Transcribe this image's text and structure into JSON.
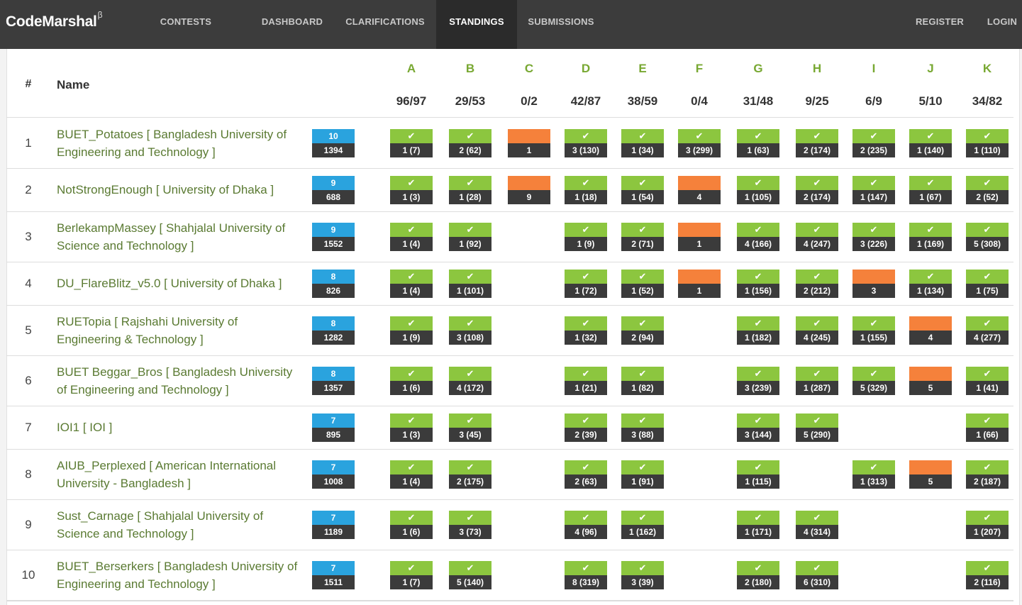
{
  "app": {
    "brand": "CodeMarshal",
    "brand_sup": "β"
  },
  "nav": {
    "items": [
      {
        "label": "CONTESTS",
        "active": false
      },
      {
        "label": "DASHBOARD",
        "active": false
      },
      {
        "label": "CLARIFICATIONS",
        "active": false
      },
      {
        "label": "STANDINGS",
        "active": true
      },
      {
        "label": "SUBMISSIONS",
        "active": false
      }
    ],
    "right": [
      {
        "label": "REGISTER"
      },
      {
        "label": "LOGIN"
      }
    ]
  },
  "colors": {
    "accepted": "#8cc63f",
    "rejected": "#f5813b",
    "solved_badge": "#2aa3de",
    "penalty_badge": "#3b3b3b",
    "team_link": "#5a7a32",
    "problem_letter": "#78a832"
  },
  "icons": {
    "accepted": "check-icon"
  },
  "header": {
    "hash": "#",
    "name": "Name"
  },
  "problems": [
    {
      "letter": "A",
      "stat": "96/97"
    },
    {
      "letter": "B",
      "stat": "29/53"
    },
    {
      "letter": "C",
      "stat": "0/2"
    },
    {
      "letter": "D",
      "stat": "42/87"
    },
    {
      "letter": "E",
      "stat": "38/59"
    },
    {
      "letter": "F",
      "stat": "0/4"
    },
    {
      "letter": "G",
      "stat": "31/48"
    },
    {
      "letter": "H",
      "stat": "9/25"
    },
    {
      "letter": "I",
      "stat": "6/9"
    },
    {
      "letter": "J",
      "stat": "5/10"
    },
    {
      "letter": "K",
      "stat": "34/82"
    }
  ],
  "rows": [
    {
      "rank": "1",
      "team": "BUET_Potatoes [ Bangladesh University of Engineering and Technology ]",
      "solved": "10",
      "penalty": "1394",
      "cells": [
        {
          "s": "ac",
          "t": "1 (7)"
        },
        {
          "s": "ac",
          "t": "2 (62)"
        },
        {
          "s": "wa",
          "t": "1"
        },
        {
          "s": "ac",
          "t": "3 (130)"
        },
        {
          "s": "ac",
          "t": "1 (34)"
        },
        {
          "s": "ac",
          "t": "3 (299)"
        },
        {
          "s": "ac",
          "t": "1 (63)"
        },
        {
          "s": "ac",
          "t": "2 (174)"
        },
        {
          "s": "ac",
          "t": "2 (235)"
        },
        {
          "s": "ac",
          "t": "1 (140)"
        },
        {
          "s": "ac",
          "t": "1 (110)"
        }
      ]
    },
    {
      "rank": "2",
      "team": "NotStrongEnough [ University of Dhaka ]",
      "solved": "9",
      "penalty": "688",
      "cells": [
        {
          "s": "ac",
          "t": "1 (3)"
        },
        {
          "s": "ac",
          "t": "1 (28)"
        },
        {
          "s": "wa",
          "t": "9"
        },
        {
          "s": "ac",
          "t": "1 (18)"
        },
        {
          "s": "ac",
          "t": "1 (54)"
        },
        {
          "s": "wa",
          "t": "4"
        },
        {
          "s": "ac",
          "t": "1 (105)"
        },
        {
          "s": "ac",
          "t": "2 (174)"
        },
        {
          "s": "ac",
          "t": "1 (147)"
        },
        {
          "s": "ac",
          "t": "1 (67)"
        },
        {
          "s": "ac",
          "t": "2 (52)"
        }
      ]
    },
    {
      "rank": "3",
      "team": "BerlekampMassey [ Shahjalal University of Science and Technology ]",
      "solved": "9",
      "penalty": "1552",
      "cells": [
        {
          "s": "ac",
          "t": "1 (4)"
        },
        {
          "s": "ac",
          "t": "1 (92)"
        },
        null,
        {
          "s": "ac",
          "t": "1 (9)"
        },
        {
          "s": "ac",
          "t": "2 (71)"
        },
        {
          "s": "wa",
          "t": "1"
        },
        {
          "s": "ac",
          "t": "4 (166)"
        },
        {
          "s": "ac",
          "t": "4 (247)"
        },
        {
          "s": "ac",
          "t": "3 (226)"
        },
        {
          "s": "ac",
          "t": "1 (169)"
        },
        {
          "s": "ac",
          "t": "5 (308)"
        }
      ]
    },
    {
      "rank": "4",
      "team": "DU_FlareBlitz_v5.0 [ University of Dhaka ]",
      "solved": "8",
      "penalty": "826",
      "cells": [
        {
          "s": "ac",
          "t": "1 (4)"
        },
        {
          "s": "ac",
          "t": "1 (101)"
        },
        null,
        {
          "s": "ac",
          "t": "1 (72)"
        },
        {
          "s": "ac",
          "t": "1 (52)"
        },
        {
          "s": "wa",
          "t": "1"
        },
        {
          "s": "ac",
          "t": "1 (156)"
        },
        {
          "s": "ac",
          "t": "2 (212)"
        },
        {
          "s": "wa",
          "t": "3"
        },
        {
          "s": "ac",
          "t": "1 (134)"
        },
        {
          "s": "ac",
          "t": "1 (75)"
        }
      ]
    },
    {
      "rank": "5",
      "team": "RUETopia [ Rajshahi University of Engineering & Technology ]",
      "solved": "8",
      "penalty": "1282",
      "cells": [
        {
          "s": "ac",
          "t": "1 (9)"
        },
        {
          "s": "ac",
          "t": "3 (108)"
        },
        null,
        {
          "s": "ac",
          "t": "1 (32)"
        },
        {
          "s": "ac",
          "t": "2 (94)"
        },
        null,
        {
          "s": "ac",
          "t": "1 (182)"
        },
        {
          "s": "ac",
          "t": "4 (245)"
        },
        {
          "s": "ac",
          "t": "1 (155)"
        },
        {
          "s": "wa",
          "t": "4"
        },
        {
          "s": "ac",
          "t": "4 (277)"
        }
      ]
    },
    {
      "rank": "6",
      "team": "BUET Beggar_Bros [ Bangladesh University of Engineering and Technology ]",
      "solved": "8",
      "penalty": "1357",
      "cells": [
        {
          "s": "ac",
          "t": "1 (6)"
        },
        {
          "s": "ac",
          "t": "4 (172)"
        },
        null,
        {
          "s": "ac",
          "t": "1 (21)"
        },
        {
          "s": "ac",
          "t": "1 (82)"
        },
        null,
        {
          "s": "ac",
          "t": "3 (239)"
        },
        {
          "s": "ac",
          "t": "1 (287)"
        },
        {
          "s": "ac",
          "t": "5 (329)"
        },
        {
          "s": "wa",
          "t": "5"
        },
        {
          "s": "ac",
          "t": "1 (41)"
        }
      ]
    },
    {
      "rank": "7",
      "team": "IOI1 [ IOI ]",
      "solved": "7",
      "penalty": "895",
      "cells": [
        {
          "s": "ac",
          "t": "1 (3)"
        },
        {
          "s": "ac",
          "t": "3 (45)"
        },
        null,
        {
          "s": "ac",
          "t": "2 (39)"
        },
        {
          "s": "ac",
          "t": "3 (88)"
        },
        null,
        {
          "s": "ac",
          "t": "3 (144)"
        },
        {
          "s": "ac",
          "t": "5 (290)"
        },
        null,
        null,
        {
          "s": "ac",
          "t": "1 (66)"
        }
      ]
    },
    {
      "rank": "8",
      "team": "AIUB_Perplexed [ American International University - Bangladesh ]",
      "solved": "7",
      "penalty": "1008",
      "cells": [
        {
          "s": "ac",
          "t": "1 (4)"
        },
        {
          "s": "ac",
          "t": "2 (175)"
        },
        null,
        {
          "s": "ac",
          "t": "2 (63)"
        },
        {
          "s": "ac",
          "t": "1 (91)"
        },
        null,
        {
          "s": "ac",
          "t": "1 (115)"
        },
        null,
        {
          "s": "ac",
          "t": "1 (313)"
        },
        {
          "s": "wa",
          "t": "5"
        },
        {
          "s": "ac",
          "t": "2 (187)"
        }
      ]
    },
    {
      "rank": "9",
      "team": "Sust_Carnage [ Shahjalal University of Science and Technology ]",
      "solved": "7",
      "penalty": "1189",
      "cells": [
        {
          "s": "ac",
          "t": "1 (6)"
        },
        {
          "s": "ac",
          "t": "3 (73)"
        },
        null,
        {
          "s": "ac",
          "t": "4 (96)"
        },
        {
          "s": "ac",
          "t": "1 (162)"
        },
        null,
        {
          "s": "ac",
          "t": "1 (171)"
        },
        {
          "s": "ac",
          "t": "4 (314)"
        },
        null,
        null,
        {
          "s": "ac",
          "t": "1 (207)"
        }
      ]
    },
    {
      "rank": "10",
      "team": "BUET_Berserkers [ Bangladesh University of Engineering and Technology ]",
      "solved": "7",
      "penalty": "1511",
      "cells": [
        {
          "s": "ac",
          "t": "1 (7)"
        },
        {
          "s": "ac",
          "t": "5 (140)"
        },
        null,
        {
          "s": "ac",
          "t": "8 (319)"
        },
        {
          "s": "ac",
          "t": "3 (39)"
        },
        null,
        {
          "s": "ac",
          "t": "2 (180)"
        },
        {
          "s": "ac",
          "t": "6 (310)"
        },
        null,
        null,
        {
          "s": "ac",
          "t": "2 (116)"
        }
      ]
    }
  ]
}
